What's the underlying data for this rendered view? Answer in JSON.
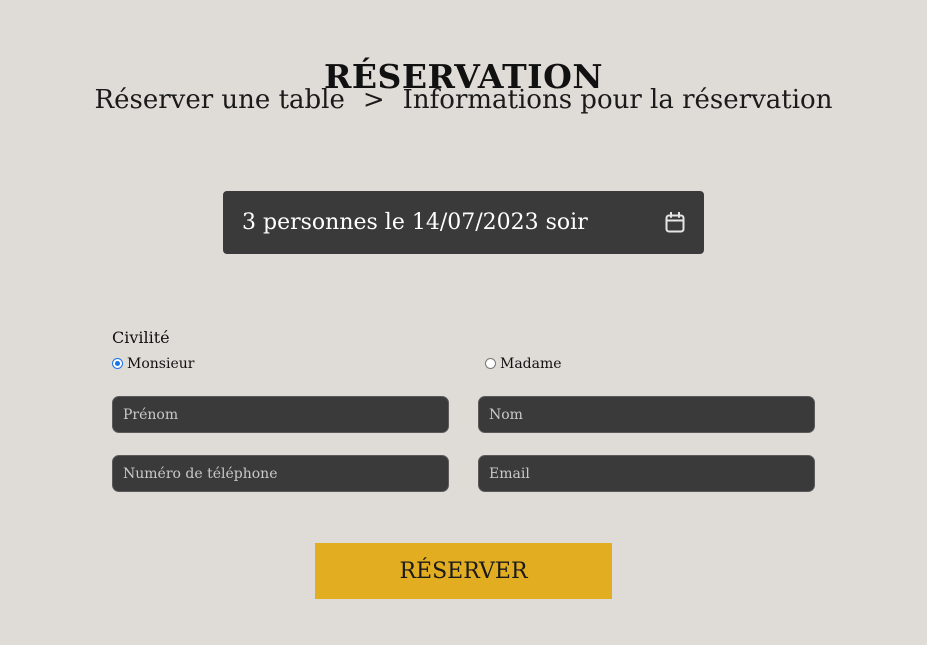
{
  "page": {
    "title": "RÉSERVATION",
    "breadcrumb": {
      "step1": "Réserver une table",
      "separator": ">",
      "step2": "Informations pour la réservation"
    }
  },
  "booking_summary": {
    "text": "3 personnes le 14/07/2023 soir",
    "icon": "calendar-icon"
  },
  "form": {
    "civility": {
      "label": "Civilité",
      "options": [
        {
          "label": "Monsieur",
          "selected": true
        },
        {
          "label": "Madame",
          "selected": false
        }
      ]
    },
    "fields": {
      "first_name": {
        "placeholder": "Prénom",
        "value": ""
      },
      "last_name": {
        "placeholder": "Nom",
        "value": ""
      },
      "phone": {
        "placeholder": "Numéro de téléphone",
        "value": ""
      },
      "email": {
        "placeholder": "Email",
        "value": ""
      }
    },
    "submit_label": "RÉSERVER"
  },
  "colors": {
    "background": "#dfdbd7",
    "field_background": "#3a3a3a",
    "accent": "#e2ad20",
    "radio_selected": "#1a73e8"
  }
}
